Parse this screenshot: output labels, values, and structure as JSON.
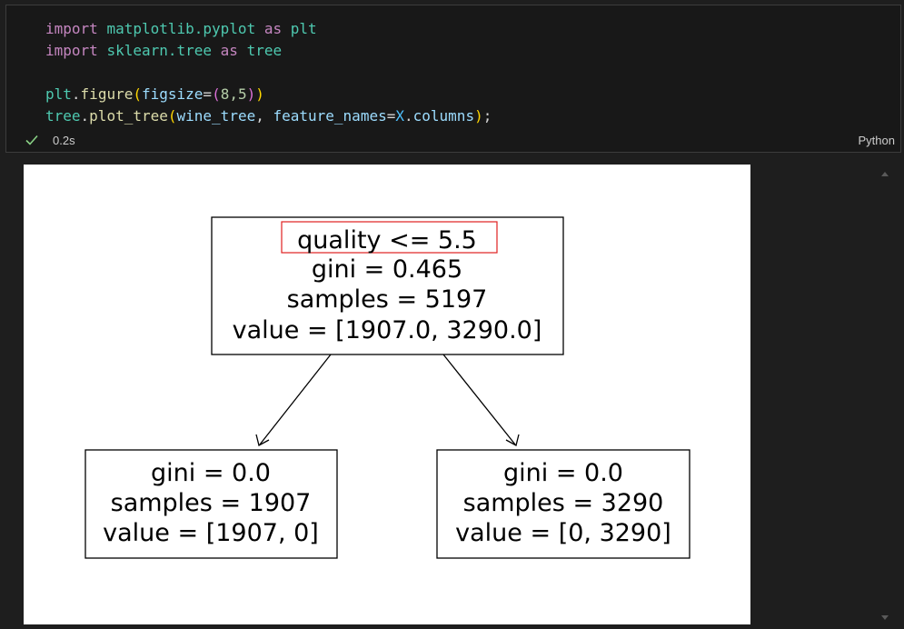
{
  "code": {
    "line1": {
      "kw": "import",
      "mod": "matplotlib.pyplot",
      "as": "as",
      "alias": "plt"
    },
    "line2": {
      "kw": "import",
      "mod": "sklearn.tree",
      "as": "as",
      "alias": "tree"
    },
    "line4": {
      "obj": "plt",
      "fn": "figure",
      "param": "figsize",
      "args": "8,5"
    },
    "line5": {
      "obj": "tree",
      "fn": "plot_tree",
      "arg1": "wine_tree",
      "param": "feature_names",
      "obj2": "X",
      "attr": "columns"
    }
  },
  "status": {
    "exec_time": "0.2s",
    "language": "Python",
    "check_icon": "check-icon",
    "success_color": "#89d185"
  },
  "tree": {
    "root": {
      "split": "quality <= 5.5",
      "gini": "gini = 0.465",
      "samples": "samples = 5197",
      "value": "value = [1907.0, 3290.0]"
    },
    "left": {
      "gini": "gini = 0.0",
      "samples": "samples = 1907",
      "value": "value = [1907, 0]"
    },
    "right": {
      "gini": "gini = 0.0",
      "samples": "samples = 3290",
      "value": "value = [0, 3290]"
    },
    "highlight_color": "#e02020"
  }
}
